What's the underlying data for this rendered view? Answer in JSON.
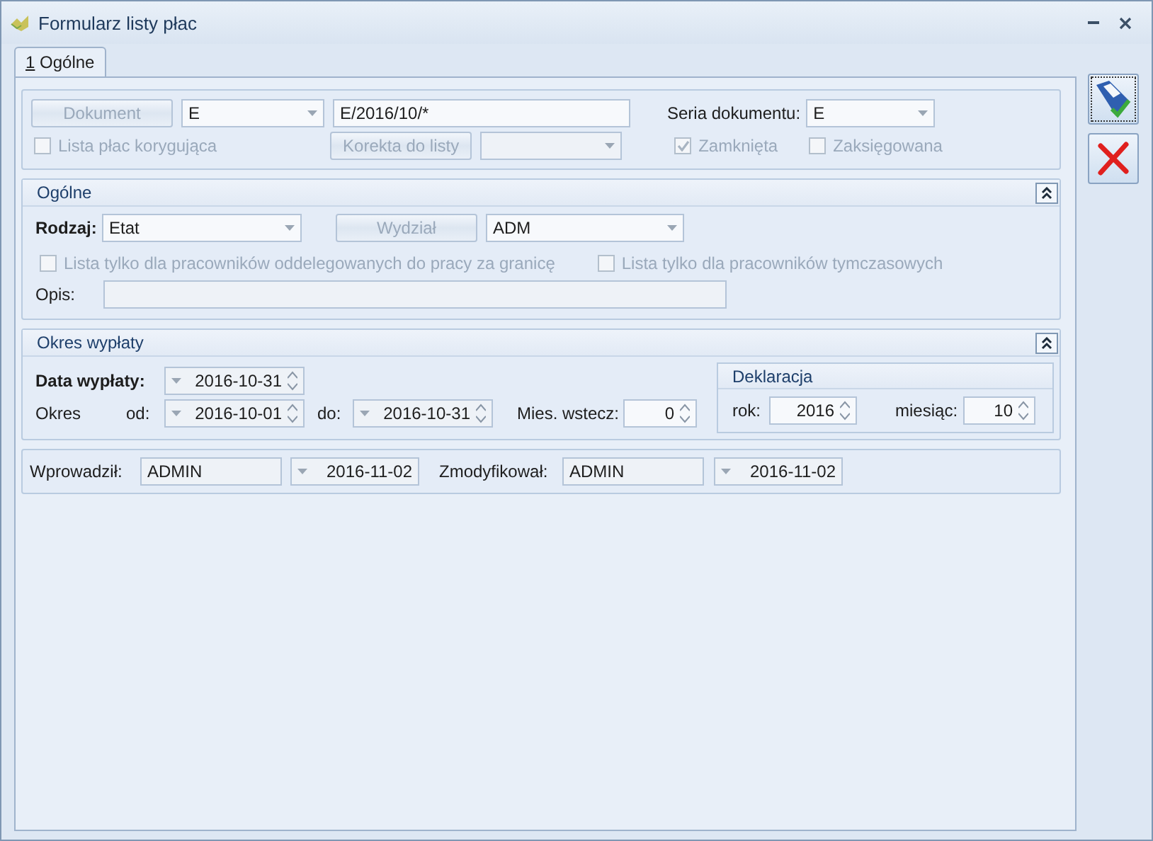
{
  "window": {
    "title": "Formularz listy płac"
  },
  "tabs": [
    {
      "hotkey": "1",
      "label": "Ogólne",
      "selected": true
    }
  ],
  "document": {
    "dokument_button": {
      "label": "Dokument",
      "disabled": true
    },
    "type_combo": "E",
    "number": "E/2016/10/*",
    "seria_label": "Seria dokumentu:",
    "seria_combo": "E",
    "korygujaca": {
      "label": "Lista płac korygująca",
      "checked": false,
      "disabled": true
    },
    "korekta_button": {
      "label": "Korekta do listy",
      "disabled": true
    },
    "zamknieta": {
      "label": "Zamknięta",
      "checked": true,
      "disabled": true
    },
    "zaksiegowana": {
      "label": "Zaksięgowana",
      "checked": false,
      "disabled": true
    }
  },
  "ogolne": {
    "title": "Ogólne",
    "expanded": true,
    "rodzaj_label": "Rodzaj:",
    "rodzaj_combo": "Etat",
    "wydzial_button": {
      "label": "Wydział",
      "disabled": true
    },
    "wydzial_combo": "ADM",
    "checkboxes": [
      {
        "label": "Lista tylko dla pracowników oddelegowanych do pracy za granicę",
        "checked": false,
        "disabled": true
      },
      {
        "label": "Lista tylko dla pracowników tymczasowych",
        "checked": false,
        "disabled": true
      }
    ],
    "opis_label": "Opis:"
  },
  "okres": {
    "title": "Okres wypłaty",
    "expanded": true,
    "data_label": "Data wypłaty:",
    "data_value": "2016-10-31",
    "okres_label": "Okres",
    "od_label": "od:",
    "od_value": "2016-10-01",
    "do_label": "do:",
    "do_value": "2016-10-31",
    "mies_label": "Mies. wstecz:",
    "mies_value": "0",
    "deklaracja": {
      "title": "Deklaracja",
      "rok_label": "rok:",
      "rok_value": "2016",
      "miesiac_label": "miesiąc:",
      "miesiac_value": "10"
    }
  },
  "audit": {
    "wprowadzil_label": "Wprowadził:",
    "wprowadzil_user": "ADMIN",
    "wprowadzil_date": "2016-11-02",
    "zmodyfikowal_label": "Zmodyfikował:",
    "zmodyfikowal_user": "ADMIN",
    "zmodyfikowal_date": "2016-11-02"
  }
}
